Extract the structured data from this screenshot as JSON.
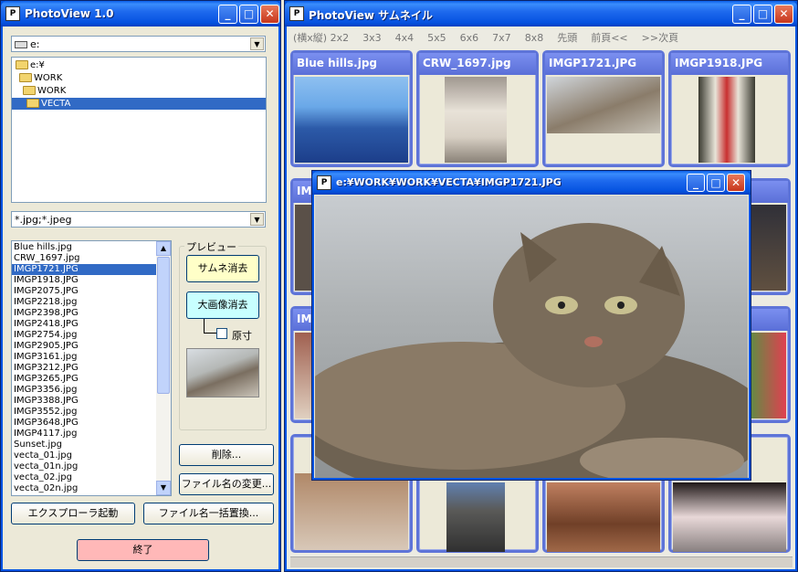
{
  "main": {
    "title": "PhotoView 1.0",
    "drive": "e:",
    "tree": [
      "e:¥",
      "WORK",
      "WORK",
      "VECTA"
    ],
    "filter": "*.jpg;*.jpeg",
    "files": [
      "Blue hills.jpg",
      "CRW_1697.jpg",
      "IMGP1721.JPG",
      "IMGP1918.JPG",
      "IMGP2075.JPG",
      "IMGP2218.jpg",
      "IMGP2398.JPG",
      "IMGP2418.JPG",
      "IMGP2754.jpg",
      "IMGP2905.JPG",
      "IMGP3161.jpg",
      "IMGP3212.JPG",
      "IMGP3265.JPG",
      "IMGP3356.jpg",
      "IMGP3388.JPG",
      "IMGP3552.jpg",
      "IMGP3648.JPG",
      "IMGP4117.jpg",
      "Sunset.jpg",
      "vecta_01.jpg",
      "vecta_01n.jpg",
      "vecta_02.jpg",
      "vecta_02n.jpg"
    ],
    "preview_label": "プレビュー",
    "thumb_clear": "サムネ消去",
    "large_clear": "大画像消去",
    "original_size": "原寸",
    "delete": "削除...",
    "rename": "ファイル名の変更...",
    "explorer": "エクスプローラ起動",
    "batch_rename": "ファイル名一括置換...",
    "exit": "終了"
  },
  "thumbwin": {
    "title": "PhotoView サムネイル",
    "menu": [
      "(横x縦) 2x2",
      "3x3",
      "4x4",
      "5x5",
      "6x6",
      "7x7",
      "8x8",
      "先頭",
      "前頁<<",
      ">>次頁"
    ],
    "captions": [
      "Blue hills.jpg",
      "CRW_1697.jpg",
      "IMGP1721.JPG",
      "IMGP1918.JPG",
      "IM",
      "IM",
      "IM",
      "IM"
    ]
  },
  "viewer": {
    "title": "e:¥WORK¥WORK¥VECTA¥IMGP1721.JPG"
  },
  "colors": {
    "titlebar": "#0552e0",
    "selection": "#316ac5",
    "thumb_border": "#5e74d8"
  }
}
